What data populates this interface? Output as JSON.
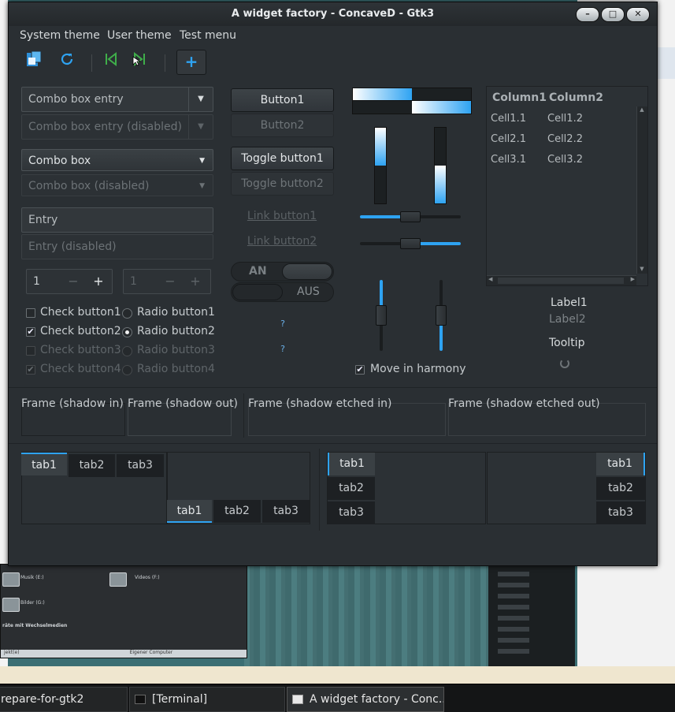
{
  "window": {
    "title": "A widget factory - ConcaveD - Gtk3",
    "controls": {
      "minimize": "–",
      "maximize": "□",
      "close": "✕"
    }
  },
  "menubar": {
    "items": [
      "System theme",
      "User theme",
      "Test menu"
    ]
  },
  "toolbar": {
    "icons": [
      "open-icon",
      "refresh-icon",
      "go-first-icon",
      "go-last-icon",
      "add-icon"
    ],
    "add_glyph": "+"
  },
  "left": {
    "combo_entry": "Combo box entry",
    "combo_entry_disabled": "Combo box entry (disabled)",
    "combo": "Combo box",
    "combo_disabled": "Combo box (disabled)",
    "entry_placeholder": "Entry",
    "entry_disabled_placeholder": "Entry (disabled)",
    "spin_value": "1",
    "spin_disabled_value": "1",
    "spin_minus": "−",
    "spin_plus": "+",
    "checks": [
      "Check button1",
      "Check button2",
      "Check button3",
      "Check button4"
    ],
    "radios": [
      "Radio button1",
      "Radio button2",
      "Radio button3",
      "Radio button4"
    ],
    "check_mark": "✔"
  },
  "middle": {
    "button1": "Button1",
    "button2": "Button2",
    "toggle1": "Toggle button1",
    "toggle2": "Toggle button2",
    "link1": "Link button1",
    "link2": "Link button2",
    "switch_on": "AN",
    "switch_off": "AUS",
    "missing_glyph": "?"
  },
  "progress": {
    "hbar1": 0.5,
    "hbar2": 0.5,
    "vbar1": 0.5,
    "vbar2": 0.5,
    "hscale1": 0.5,
    "hscale2": 0.5,
    "vscale1": 0.5,
    "vscale2": 0.5,
    "move_in_harmony": "Move in harmony"
  },
  "tree": {
    "columns": [
      "Column1",
      "Column2"
    ],
    "rows": [
      [
        "Cell1.1",
        "Cell1.2"
      ],
      [
        "Cell2.1",
        "Cell2.2"
      ],
      [
        "Cell3.1",
        "Cell3.2"
      ]
    ]
  },
  "labels": {
    "label1": "Label1",
    "label2": "Label2",
    "tooltip": "Tooltip"
  },
  "frames": [
    "Frame (shadow in)",
    "Frame (shadow out)",
    "Frame (shadow etched in)",
    "Frame (shadow etched out)"
  ],
  "notebooks": {
    "tabs": [
      "tab1",
      "tab2",
      "tab3"
    ]
  },
  "taskbar": {
    "items": [
      "repare-for-gtk2",
      "[Terminal]",
      "A widget factory - Conc..."
    ]
  },
  "colors": {
    "accent": "#2ea3f2",
    "window_bg": "#2a2f33"
  }
}
